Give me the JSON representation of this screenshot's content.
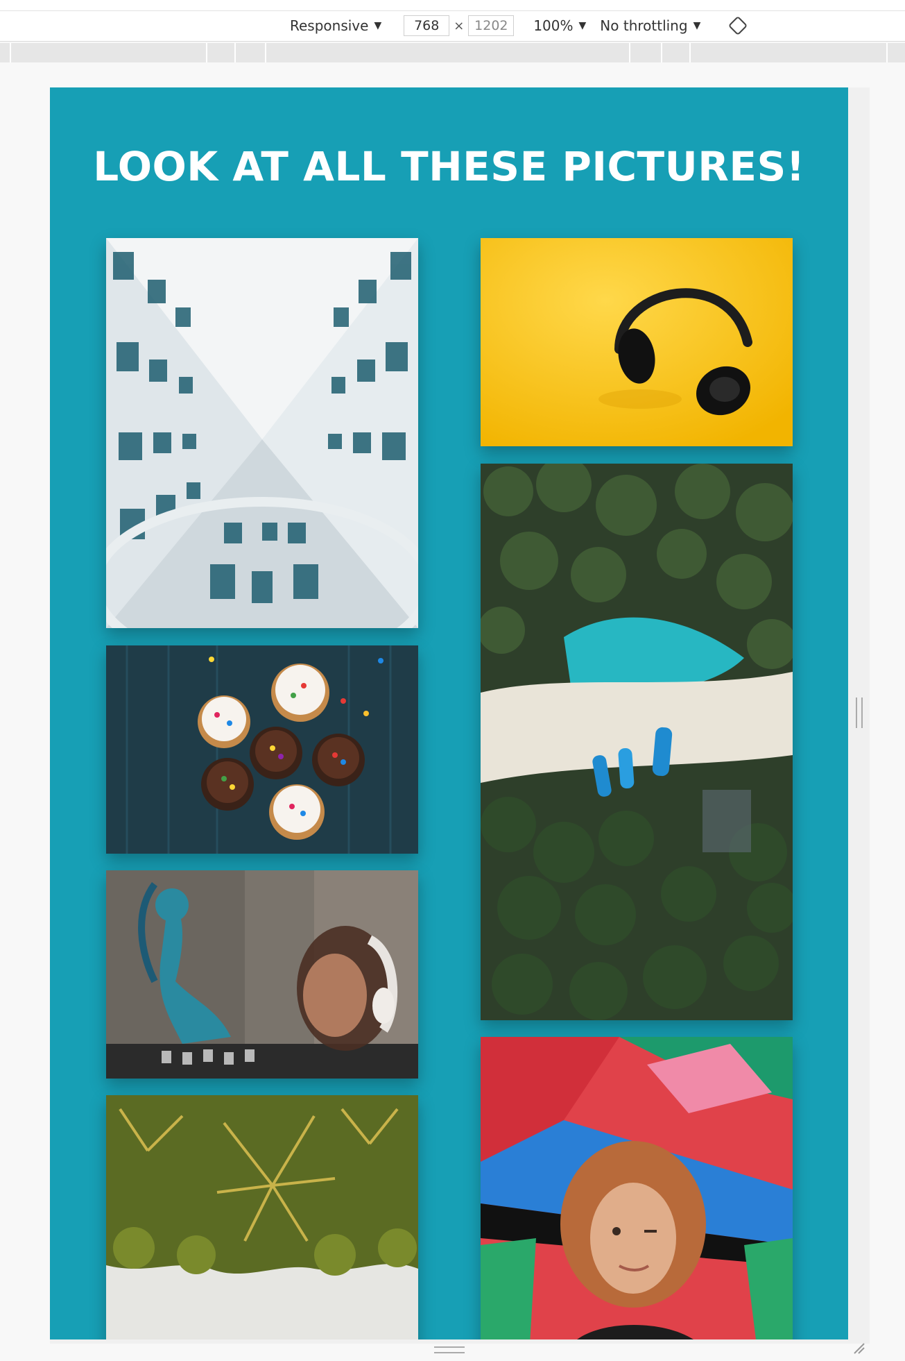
{
  "devtools": {
    "device_label": "Responsive",
    "width_value": "768",
    "height_value": "1202",
    "zoom_label": "100%",
    "throttle_label": "No throttling"
  },
  "page": {
    "title": "LOOK AT ALL THESE PICTURES!",
    "background": "#179fb5"
  },
  "gallery": {
    "images": [
      {
        "subject": "building-upward-view"
      },
      {
        "subject": "headphones-on-yellow"
      },
      {
        "subject": "cupcakes-on-dark-wood"
      },
      {
        "subject": "aerial-beach-palms-boats"
      },
      {
        "subject": "graffiti-woman-headphones"
      },
      {
        "subject": "girl-in-front-of-graffiti"
      },
      {
        "subject": "palm-trees-upside-down"
      }
    ]
  }
}
